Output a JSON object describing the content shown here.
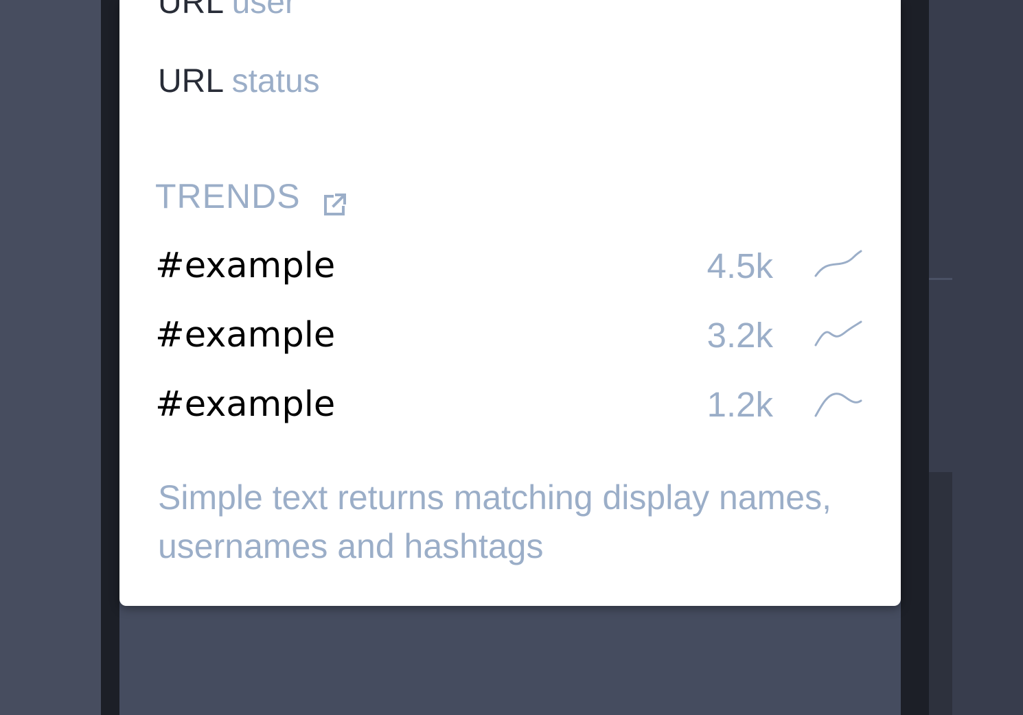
{
  "search_popout": {
    "search_options": [
      {
        "prefix": "URL",
        "hint": "user"
      },
      {
        "prefix": "URL",
        "hint": "status"
      }
    ],
    "trends": {
      "header": "TRENDS",
      "link_icon": "external-link-icon",
      "items": [
        {
          "tag": "#example",
          "count": "4.5k",
          "trend_shape": "rising"
        },
        {
          "tag": "#example",
          "count": "3.2k",
          "trend_shape": "wavy-rising"
        },
        {
          "tag": "#example",
          "count": "1.2k",
          "trend_shape": "peak-falling"
        }
      ]
    },
    "hint": "Simple text returns matching display names, usernames and hashtags"
  },
  "colors": {
    "hint_text": "#9baec8",
    "primary_text": "#282c37",
    "popout_background": "#ffffff",
    "page_background": "#454c5f"
  }
}
